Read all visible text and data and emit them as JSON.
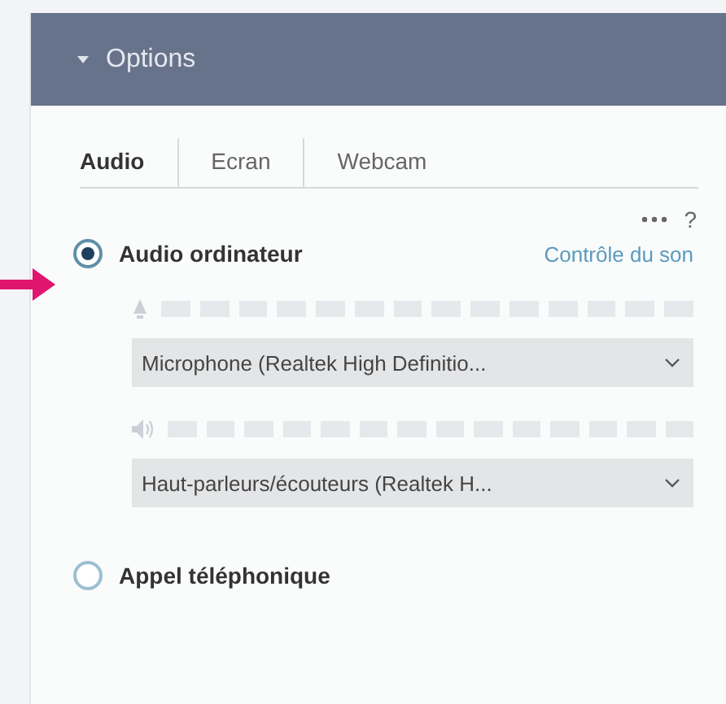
{
  "panel": {
    "title": "Options",
    "expanded": true
  },
  "tabs": [
    {
      "label": "Audio",
      "selected": true
    },
    {
      "label": "Ecran",
      "selected": false
    },
    {
      "label": "Webcam",
      "selected": false
    }
  ],
  "help": "?",
  "options": [
    {
      "label": "Audio ordinateur",
      "selected": true,
      "link": "Contrôle du son",
      "devices": [
        {
          "kind": "microphone",
          "value": "Microphone (Realtek High Definitio..."
        },
        {
          "kind": "speaker",
          "value": "Haut-parleurs/écouteurs (Realtek H..."
        }
      ]
    },
    {
      "label": "Appel téléphonique",
      "selected": false
    }
  ]
}
